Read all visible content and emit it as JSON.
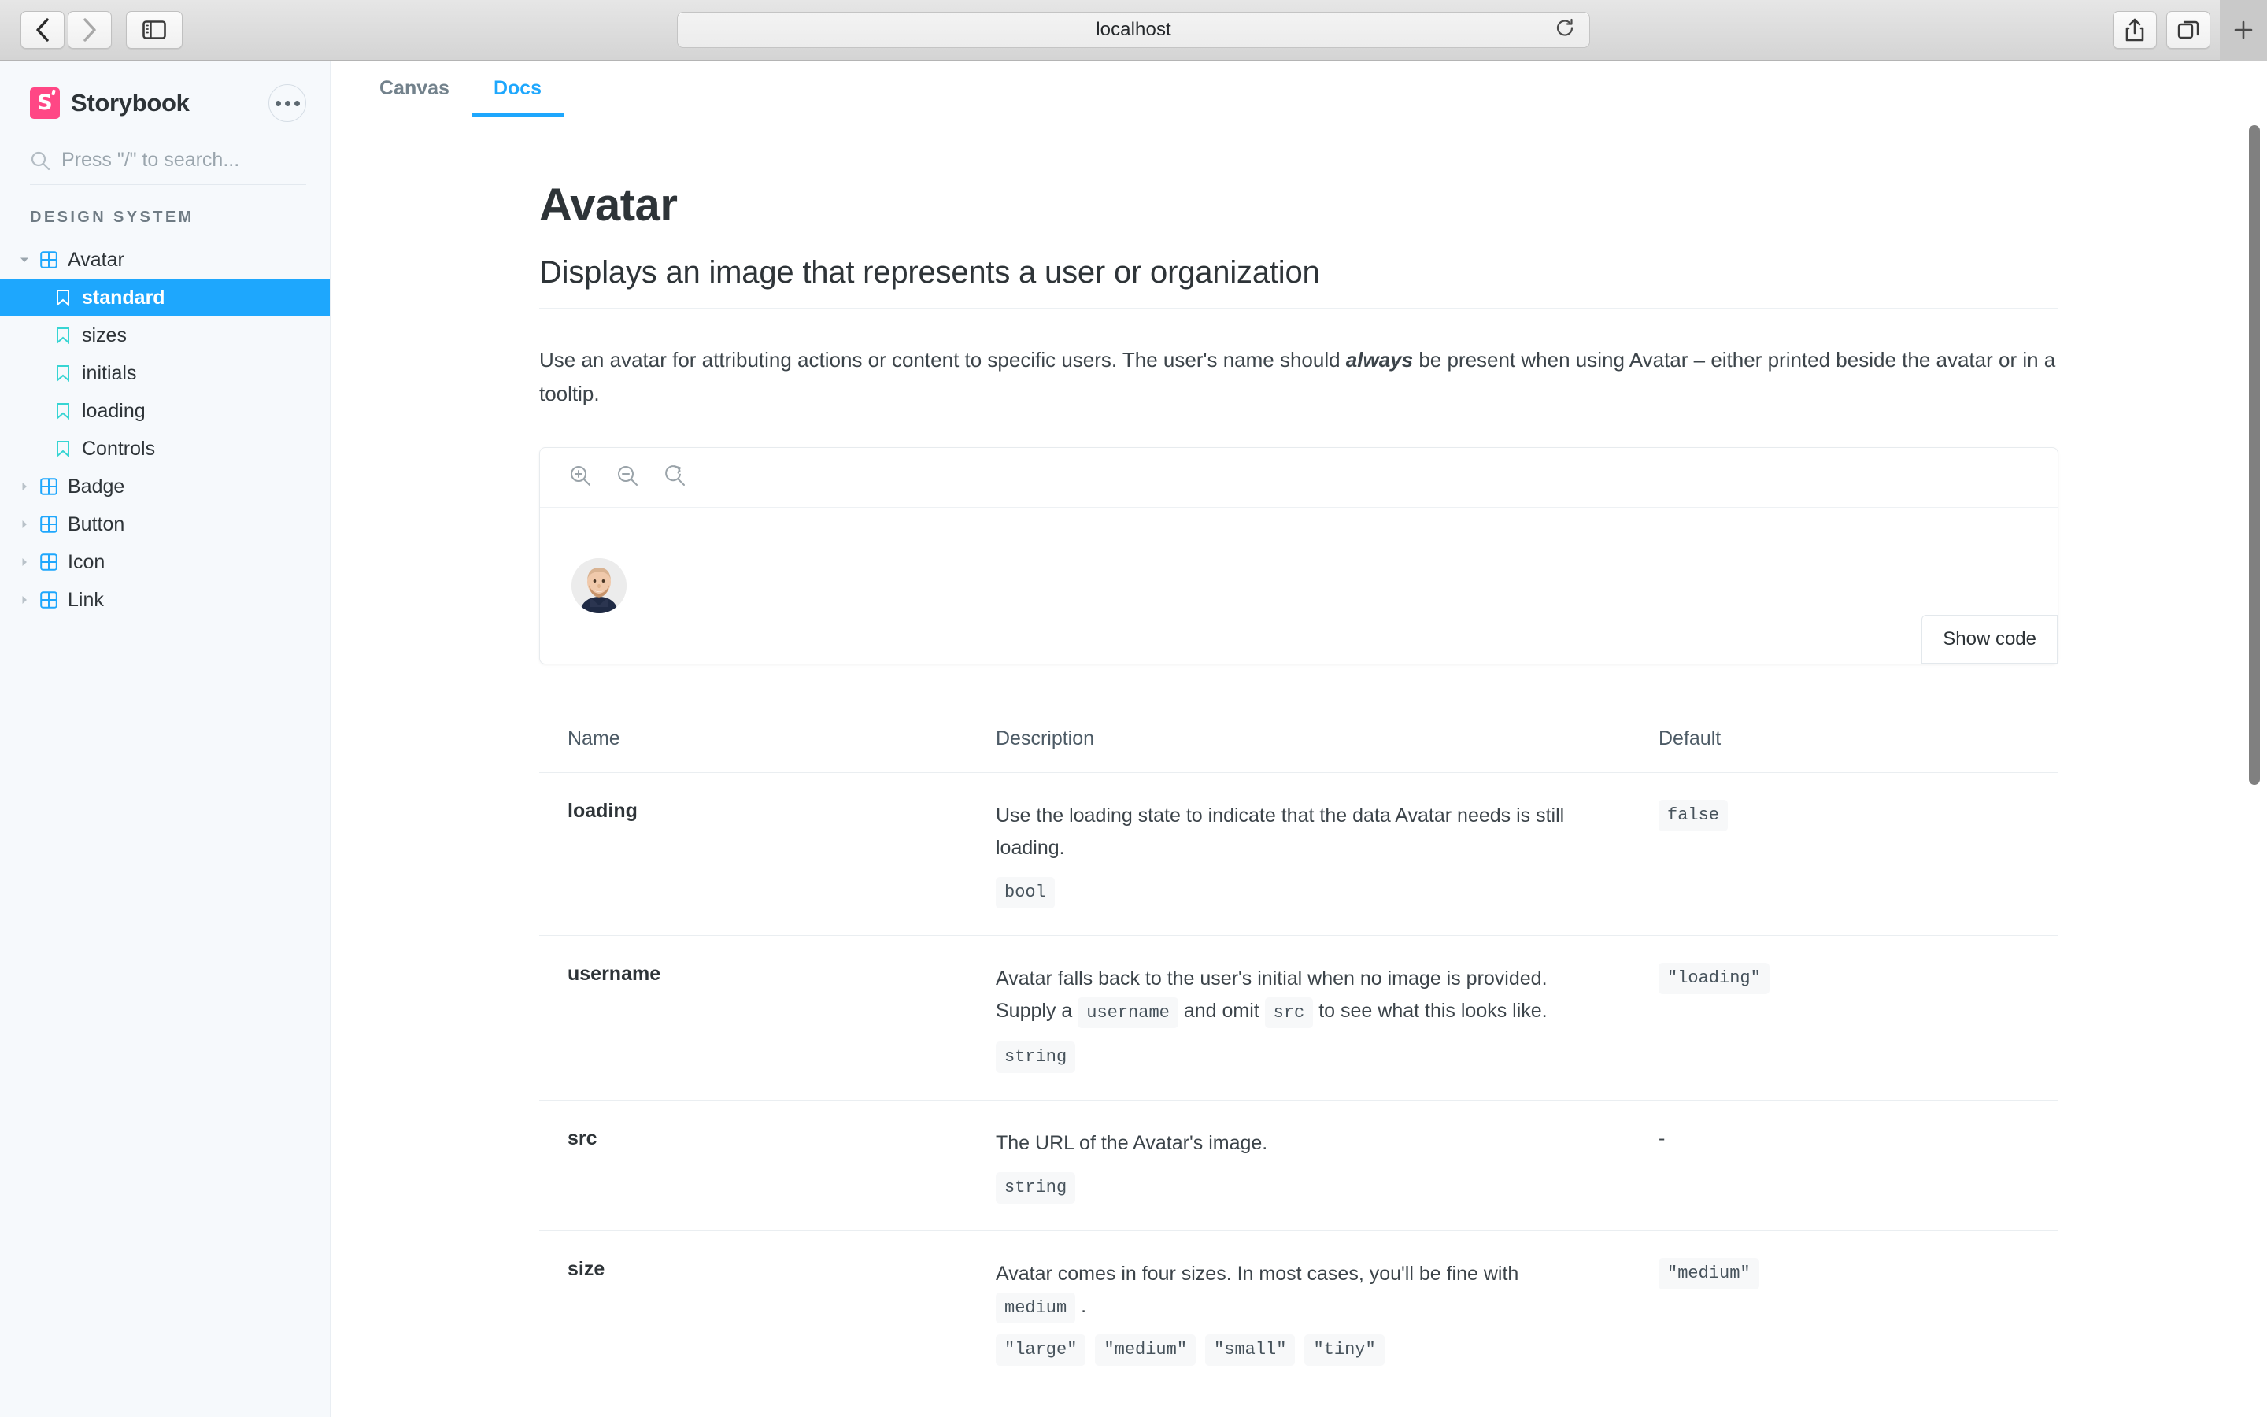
{
  "browser": {
    "url": "localhost",
    "back_label": "Back",
    "forward_label": "Forward",
    "sidebar_toggle_label": "Show sidebar",
    "reload_label": "Reload",
    "share_label": "Share",
    "tab_overview_label": "Tab overview",
    "new_tab_label": "New tab"
  },
  "sidebar": {
    "brand": "Storybook",
    "logo_letter": "S",
    "menu_label": "Menu",
    "search_placeholder": "Press \"/\" to search...",
    "section_heading": "DESIGN SYSTEM",
    "accent_selected": "#1ea7fd",
    "accent_component": "#1ea7fd",
    "accent_story": "#37d5d3",
    "brand_color": "#ff4785",
    "items": [
      {
        "label": "Avatar",
        "type": "component",
        "level": 0,
        "expanded": true,
        "selected": false
      },
      {
        "label": "standard",
        "type": "story",
        "level": 1,
        "expanded": false,
        "selected": true
      },
      {
        "label": "sizes",
        "type": "story",
        "level": 1,
        "expanded": false,
        "selected": false
      },
      {
        "label": "initials",
        "type": "story",
        "level": 1,
        "expanded": false,
        "selected": false
      },
      {
        "label": "loading",
        "type": "story",
        "level": 1,
        "expanded": false,
        "selected": false
      },
      {
        "label": "Controls",
        "type": "story",
        "level": 1,
        "expanded": false,
        "selected": false
      },
      {
        "label": "Badge",
        "type": "component",
        "level": 0,
        "expanded": false,
        "selected": false
      },
      {
        "label": "Button",
        "type": "component",
        "level": 0,
        "expanded": false,
        "selected": false
      },
      {
        "label": "Icon",
        "type": "component",
        "level": 0,
        "expanded": false,
        "selected": false
      },
      {
        "label": "Link",
        "type": "component",
        "level": 0,
        "expanded": false,
        "selected": false
      }
    ]
  },
  "tabs": [
    {
      "label": "Canvas",
      "active": false
    },
    {
      "label": "Docs",
      "active": true
    }
  ],
  "doc": {
    "title": "Avatar",
    "subtitle": "Displays an image that represents a user or organization",
    "body_part1": "Use an avatar for attributing actions or content to specific users. The user's name should ",
    "body_emphasis": "always",
    "body_part2": " be present when using Avatar – either printed beside the avatar or in a tooltip."
  },
  "preview": {
    "zoom_in_label": "Zoom in",
    "zoom_out_label": "Zoom out",
    "zoom_reset_label": "Reset zoom",
    "show_code_label": "Show code",
    "avatar_alt": "User avatar"
  },
  "props_table": {
    "columns": [
      "Name",
      "Description",
      "Default"
    ],
    "rows": [
      {
        "name": "loading",
        "description_parts": [
          {
            "kind": "text",
            "value": "Use the loading state to indicate that the data Avatar needs is still loading."
          }
        ],
        "type": "bool",
        "enum": [],
        "default": "false",
        "default_is_chip": true
      },
      {
        "name": "username",
        "description_parts": [
          {
            "kind": "text",
            "value": "Avatar falls back to the user's initial when no image is provided. Supply a "
          },
          {
            "kind": "code",
            "value": "username"
          },
          {
            "kind": "text",
            "value": " and omit "
          },
          {
            "kind": "code",
            "value": "src"
          },
          {
            "kind": "text",
            "value": " to see what this looks like."
          }
        ],
        "type": "string",
        "enum": [],
        "default": "\"loading\"",
        "default_is_chip": true
      },
      {
        "name": "src",
        "description_parts": [
          {
            "kind": "text",
            "value": "The URL of the Avatar's image."
          }
        ],
        "type": "string",
        "enum": [],
        "default": "-",
        "default_is_chip": false
      },
      {
        "name": "size",
        "description_parts": [
          {
            "kind": "text",
            "value": "Avatar comes in four sizes. In most cases, you'll be fine with "
          },
          {
            "kind": "code",
            "value": "medium"
          },
          {
            "kind": "text",
            "value": " ."
          }
        ],
        "type": "",
        "enum": [
          "\"large\"",
          "\"medium\"",
          "\"small\"",
          "\"tiny\""
        ],
        "default": "\"medium\"",
        "default_is_chip": true
      }
    ]
  }
}
